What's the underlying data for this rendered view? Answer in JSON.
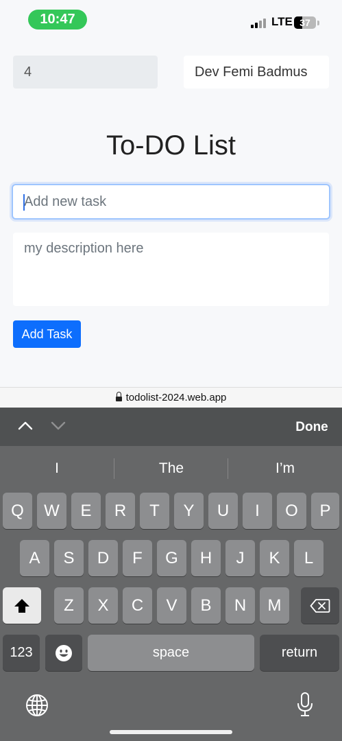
{
  "status_bar": {
    "time": "10:47",
    "network": "LTE",
    "battery": "37",
    "battery_level_percent": 37,
    "icons": [
      "cellular-signal-icon",
      "battery-icon"
    ]
  },
  "header": {
    "number_field_value": "4",
    "name_field_value": "Dev Femi Badmus"
  },
  "main": {
    "title": "To-DO List",
    "task_placeholder": "Add new task",
    "description_placeholder": "my description here",
    "add_button_label": "Add Task"
  },
  "browser": {
    "url": "todolist-2024.web.app",
    "icon": "lock-icon"
  },
  "accessory_bar": {
    "done_label": "Done",
    "icons": [
      "chevron-up-icon",
      "chevron-down-icon"
    ]
  },
  "keyboard": {
    "suggestions": [
      "I",
      "The",
      "I’m"
    ],
    "row1": [
      "Q",
      "W",
      "E",
      "R",
      "T",
      "Y",
      "U",
      "I",
      "O",
      "P"
    ],
    "row2": [
      "A",
      "S",
      "D",
      "F",
      "G",
      "H",
      "J",
      "K",
      "L"
    ],
    "row3": [
      "Z",
      "X",
      "C",
      "V",
      "B",
      "N",
      "M"
    ],
    "numbers_label": "123",
    "space_label": "space",
    "return_label": "return",
    "icons": [
      "shift-icon",
      "backspace-icon",
      "emoji-icon",
      "globe-icon",
      "microphone-icon"
    ]
  },
  "colors": {
    "time_pill": "#34c759",
    "primary_button": "#0d6efd",
    "focus_border": "#9ec5fe",
    "keyboard_bg": "#666768"
  }
}
